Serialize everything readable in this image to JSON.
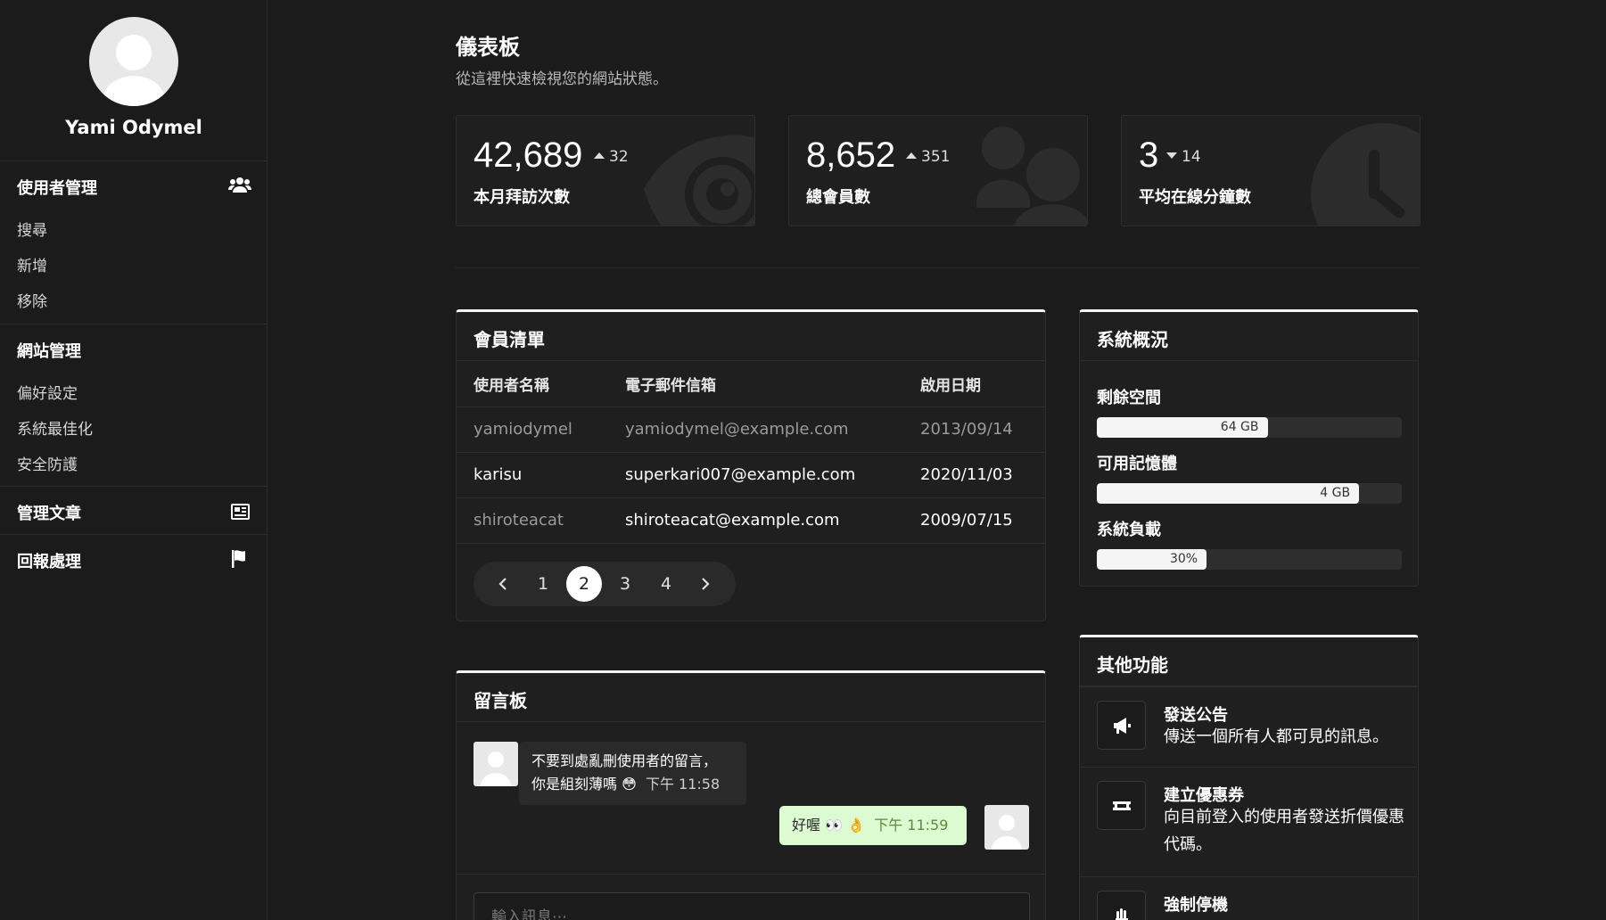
{
  "user": {
    "name": "Yami Odymel"
  },
  "sidebar": {
    "sections": [
      {
        "title": "使用者管理",
        "icon": "users-icon",
        "items": [
          "搜尋",
          "新增",
          "移除"
        ]
      },
      {
        "title": "網站管理",
        "items": [
          "偏好設定",
          "系統最佳化",
          "安全防護"
        ]
      },
      {
        "title": "管理文章",
        "icon": "newspaper-icon"
      },
      {
        "title": "回報處理",
        "icon": "flag-icon"
      }
    ]
  },
  "header": {
    "title": "儀表板",
    "subtitle": "從這裡快速檢視您的網站狀態。"
  },
  "stats": [
    {
      "value": "42,689",
      "delta": "32",
      "direction": "up",
      "label": "本月拜訪次數",
      "icon": "eye-icon"
    },
    {
      "value": "8,652",
      "delta": "351",
      "direction": "up",
      "label": "總會員數",
      "icon": "users-icon"
    },
    {
      "value": "3",
      "delta": "14",
      "direction": "down",
      "label": "平均在線分鐘數",
      "icon": "clock-icon"
    }
  ],
  "members": {
    "title": "會員清單",
    "columns": [
      "使用者名稱",
      "電子郵件信箱",
      "啟用日期"
    ],
    "rows": [
      [
        "yamiodymel",
        "yamiodymel@example.com",
        "2013/09/14"
      ],
      [
        "karisu",
        "superkari007@example.com",
        "2020/11/03"
      ],
      [
        "shiroteacat",
        "shiroteacat@example.com",
        "2009/07/15"
      ]
    ],
    "pages": [
      "1",
      "2",
      "3",
      "4"
    ],
    "current_page": "2"
  },
  "chat": {
    "title": "留言板",
    "messages": [
      {
        "side": "left",
        "line1": "不要到處亂刪使用者的留言，",
        "line2": "你是組刻薄嗎 😳",
        "time": "下午 11:58"
      },
      {
        "side": "right",
        "text": "好喔 👀 👌",
        "time": "下午 11:59"
      }
    ],
    "input_placeholder": "輸入訊息⋯"
  },
  "system": {
    "title": "系統概況",
    "items": [
      {
        "label": "剩餘空間",
        "value": "64 GB",
        "fraction": 0.56
      },
      {
        "label": "可用記憶體",
        "value": "4 GB",
        "fraction": 0.86
      },
      {
        "label": "系統負載",
        "value": "30%",
        "fraction": 0.36
      }
    ]
  },
  "functions": {
    "title": "其他功能",
    "items": [
      {
        "title": "發送公告",
        "desc": "傳送一個所有人都可見的訊息。",
        "icon": "megaphone-icon"
      },
      {
        "title": "建立優惠券",
        "desc": "向目前登入的使用者發送折價優惠代碼。",
        "icon": "ticket-icon"
      },
      {
        "title": "強制停機",
        "icon": "hand-icon"
      }
    ]
  }
}
